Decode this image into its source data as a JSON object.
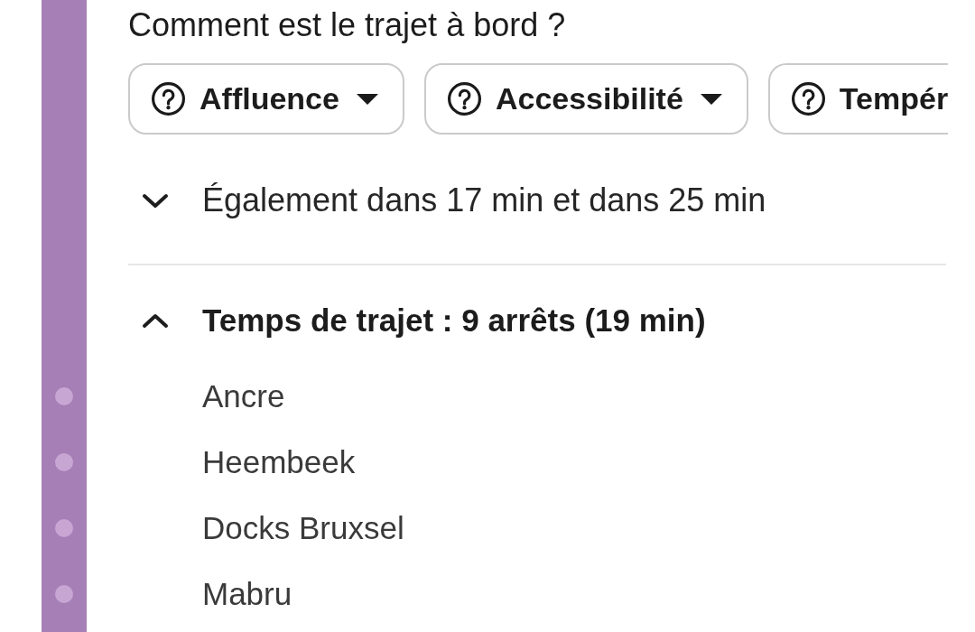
{
  "question": "Comment est le trajet à bord ?",
  "feedback_chips": [
    {
      "label": "Affluence",
      "cut_off": false
    },
    {
      "label": "Accessibilité",
      "cut_off": false
    },
    {
      "label": "Tempér",
      "cut_off": true
    }
  ],
  "more_departures": {
    "text": "Également dans 17 min et dans 25 min",
    "expanded": false
  },
  "journey": {
    "title": "Temps de trajet : 9 arrêts (19 min)",
    "expanded": true,
    "stops": [
      "Ancre",
      "Heembeek",
      "Docks Bruxsel",
      "Mabru"
    ]
  }
}
